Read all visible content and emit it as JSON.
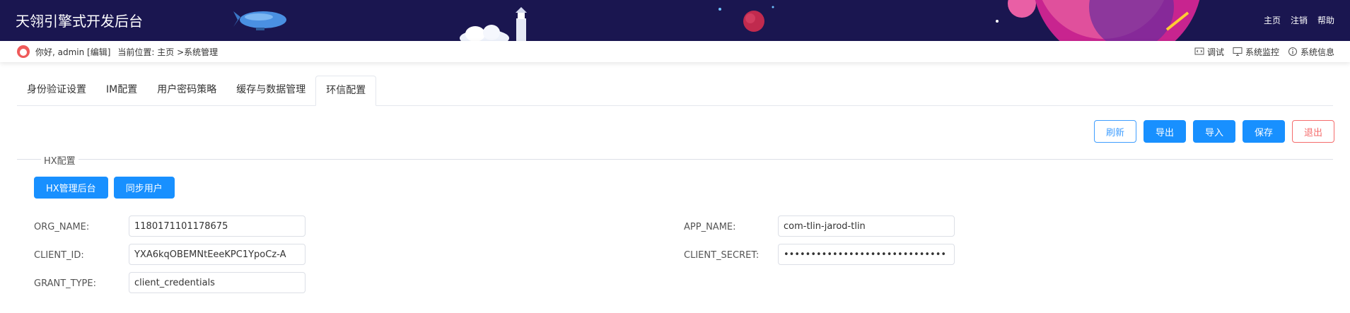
{
  "header": {
    "title": "天翎引擎式开发后台",
    "nav": [
      "主页",
      "注销",
      "帮助"
    ]
  },
  "subbar": {
    "greeting": "你好, admin [编辑]",
    "location": "当前位置: 主页 >系统管理",
    "tools": [
      {
        "icon": "code-icon",
        "label": "调试"
      },
      {
        "icon": "monitor-icon",
        "label": "系统监控"
      },
      {
        "icon": "info-icon",
        "label": "系统信息"
      }
    ]
  },
  "tabs": [
    "身份验证设置",
    "IM配置",
    "用户密码策略",
    "缓存与数据管理",
    "环信配置"
  ],
  "active_tab": "环信配置",
  "actions": {
    "refresh": "刷新",
    "export": "导出",
    "import": "导入",
    "save": "保存",
    "exit": "退出"
  },
  "hx_section": {
    "legend": "HX配置",
    "admin_button": "HX管理后台",
    "sync_button": "同步用户"
  },
  "form": {
    "org_name": {
      "label": "ORG_NAME:",
      "value": "1180171101178675"
    },
    "app_name": {
      "label": "APP_NAME:",
      "value": "com-tlin-jarod-tlin"
    },
    "client_id": {
      "label": "CLIENT_ID:",
      "value": "YXA6kqOBEMNtEeeKPC1YpoCz-A"
    },
    "client_secret": {
      "label": "CLIENT_SECRET:",
      "value": "••••••••••••••••••••••••••••••"
    },
    "grant_type": {
      "label": "GRANT_TYPE:",
      "value": "client_credentials"
    }
  },
  "colors": {
    "header_bg": "#1a1650",
    "primary": "#1890ff",
    "danger": "#f56c6c"
  }
}
